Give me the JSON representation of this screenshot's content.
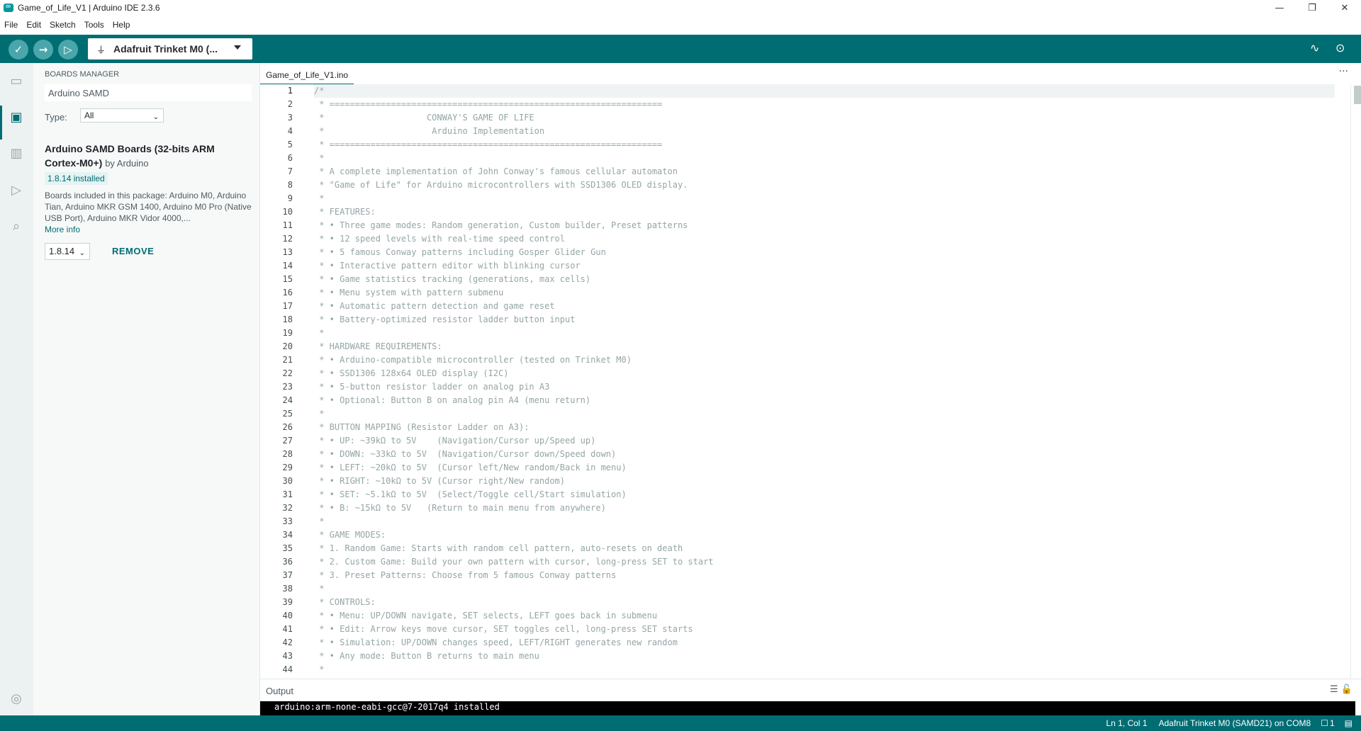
{
  "window": {
    "title": "Game_of_Life_V1 | Arduino IDE 2.3.6",
    "minimize": "—",
    "restore": "❐",
    "close": "✕"
  },
  "menu": [
    "File",
    "Edit",
    "Sketch",
    "Tools",
    "Help"
  ],
  "toolbar": {
    "verify_icon": "✓",
    "upload_icon": "→",
    "debug_icon": "▷",
    "board_label": "Adafruit Trinket M0 (...",
    "usb_icon": "⏚",
    "serial_plotter_icon": "∿",
    "serial_monitor_icon": "⊙"
  },
  "activity": {
    "sketchbook_icon": "▭",
    "boards_icon": "▣",
    "library_icon": "▥",
    "debug_icon": "▷",
    "search_icon": "⌕",
    "account_icon": "◎"
  },
  "boards_manager": {
    "header": "BOARDS MANAGER",
    "search_value": "Arduino SAMD",
    "type_label": "Type:",
    "type_value": "All",
    "board_title": "Arduino SAMD Boards (32-bits ARM Cortex-M0+)",
    "board_by": "by Arduino",
    "installed": "1.8.14 installed",
    "description": "Boards included in this package: Arduino M0, Arduino Tian, Arduino MKR GSM 1400, Arduino M0 Pro (Native USB Port), Arduino MKR Vidor 4000,...",
    "more_info": "More info",
    "version": "1.8.14",
    "remove": "REMOVE"
  },
  "editor": {
    "tab": "Game_of_Life_V1.ino",
    "more": "···",
    "lines": [
      "/*",
      " * =================================================================",
      " *                    CONWAY'S GAME OF LIFE",
      " *                     Arduino Implementation",
      " * =================================================================",
      " *",
      " * A complete implementation of John Conway's famous cellular automaton",
      " * \"Game of Life\" for Arduino microcontrollers with SSD1306 OLED display.",
      " *",
      " * FEATURES:",
      " * • Three game modes: Random generation, Custom builder, Preset patterns",
      " * • 12 speed levels with real-time speed control",
      " * • 5 famous Conway patterns including Gosper Glider Gun",
      " * • Interactive pattern editor with blinking cursor",
      " * • Game statistics tracking (generations, max cells)",
      " * • Menu system with pattern submenu",
      " * • Automatic pattern detection and game reset",
      " * • Battery-optimized resistor ladder button input",
      " *",
      " * HARDWARE REQUIREMENTS:",
      " * • Arduino-compatible microcontroller (tested on Trinket M0)",
      " * • SSD1306 128x64 OLED display (I2C)",
      " * • 5-button resistor ladder on analog pin A3",
      " * • Optional: Button B on analog pin A4 (menu return)",
      " *",
      " * BUTTON MAPPING (Resistor Ladder on A3):",
      " * • UP: ~39kΩ to 5V    (Navigation/Cursor up/Speed up)",
      " * • DOWN: ~33kΩ to 5V  (Navigation/Cursor down/Speed down)",
      " * • LEFT: ~20kΩ to 5V  (Cursor left/New random/Back in menu)",
      " * • RIGHT: ~10kΩ to 5V (Cursor right/New random)",
      " * • SET: ~5.1kΩ to 5V  (Select/Toggle cell/Start simulation)",
      " * • B: ~15kΩ to 5V   (Return to main menu from anywhere)",
      " *",
      " * GAME MODES:",
      " * 1. Random Game: Starts with random cell pattern, auto-resets on death",
      " * 2. Custom Game: Build your own pattern with cursor, long-press SET to start",
      " * 3. Preset Patterns: Choose from 5 famous Conway patterns",
      " *",
      " * CONTROLS:",
      " * • Menu: UP/DOWN navigate, SET selects, LEFT goes back in submenu",
      " * • Edit: Arrow keys move cursor, SET toggles cell, long-press SET starts",
      " * • Simulation: UP/DOWN changes speed, LEFT/RIGHT generates new random",
      " * • Any mode: Button B returns to main menu",
      " *"
    ],
    "line_numbers": [
      "1",
      "2",
      "3",
      "4",
      "5",
      "6",
      "7",
      "8",
      "9",
      "10",
      "11",
      "12",
      "13",
      "14",
      "15",
      "16",
      "17",
      "18",
      "19",
      "20",
      "21",
      "22",
      "23",
      "24",
      "25",
      "26",
      "27",
      "28",
      "29",
      "30",
      "31",
      "32",
      "33",
      "34",
      "35",
      "36",
      "37",
      "38",
      "39",
      "40",
      "41",
      "42",
      "43",
      "44"
    ]
  },
  "output": {
    "title": "Output",
    "icons": "☰ 🔓",
    "line": "arduino:arm-none-eabi-gcc@7-2017q4 installed"
  },
  "status": {
    "cursor": "Ln 1, Col 1",
    "board": "Adafruit Trinket M0 (SAMD21) on COM8",
    "notifications": "1",
    "notif_icon": "☐",
    "layout_icon": "▤"
  },
  "colors": {
    "accent": "#006d73",
    "toolbar_button": "#4ba6ab",
    "comment": "#95a5a6"
  }
}
